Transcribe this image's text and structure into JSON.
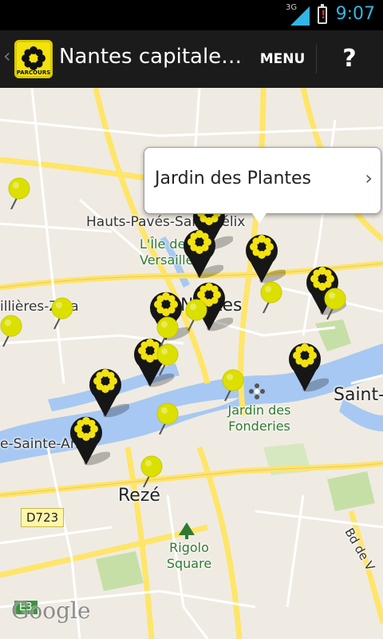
{
  "status": {
    "network": "3G",
    "time": "9:07"
  },
  "actionbar": {
    "back_icon": "chevron-left-icon",
    "logo_text": "PARCOURS",
    "title": "Nantes capitale…",
    "menu_label": "MENU",
    "help_label": "?"
  },
  "map": {
    "labels": {
      "hauts_paves": "Hauts-Pavés-Saint-Félix",
      "ile_versailles": "L'Île de Versailles",
      "nantes": "Nantes",
      "zola": "illières-Zola",
      "saint": "Saint-",
      "jardin_fonderies": "Jardin des Fonderies",
      "sainte_anne": "e-Sainte-Anne",
      "reze": "Rezé",
      "rigolo_square": "Rigolo Square",
      "bd_de": "Bd de V",
      "d723": "D723",
      "e3": "E3",
      "google": "Google"
    }
  },
  "callout": {
    "title": "Jardin des Plantes",
    "arrow": "›"
  },
  "colors": {
    "accent": "#33b5e5",
    "marker_yellow": "#f2e20e",
    "dot_yellow": "#dce000"
  }
}
